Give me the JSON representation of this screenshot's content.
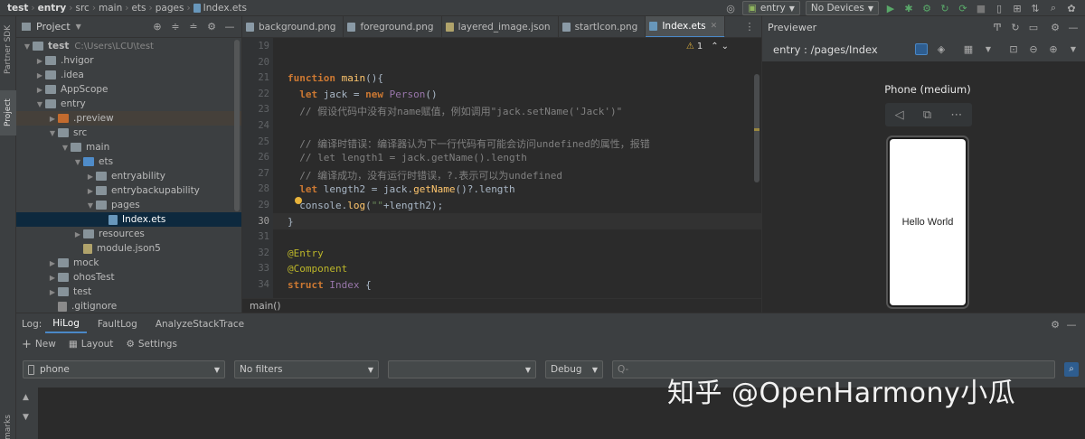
{
  "navbar": {
    "crumbs": [
      "test",
      "entry",
      "src",
      "main",
      "ets",
      "pages",
      "Index.ets"
    ],
    "entry_combo": "entry",
    "devices_combo": "No Devices"
  },
  "toolstrip": {
    "partner_sdk": "Partner SDK",
    "project": "Project",
    "marks": "marks"
  },
  "project_panel": {
    "title": "Project",
    "tree": [
      {
        "label": "test",
        "hint": "C:\\Users\\LCU\\test",
        "depth": 0,
        "icon": "folder-plain",
        "open": true
      },
      {
        "label": ".hvigor",
        "depth": 1,
        "icon": "folder-plain",
        "open": false
      },
      {
        "label": ".idea",
        "depth": 1,
        "icon": "folder-plain",
        "open": false
      },
      {
        "label": "AppScope",
        "depth": 1,
        "icon": "folder-plain",
        "open": false
      },
      {
        "label": "entry",
        "depth": 1,
        "icon": "folder-plain",
        "open": true
      },
      {
        "label": ".preview",
        "depth": 2,
        "icon": "folder-orange",
        "open": false
      },
      {
        "label": "src",
        "depth": 2,
        "icon": "folder-plain",
        "open": true
      },
      {
        "label": "main",
        "depth": 3,
        "icon": "folder-plain",
        "open": true
      },
      {
        "label": "ets",
        "depth": 4,
        "icon": "folder-src",
        "open": true
      },
      {
        "label": "entryability",
        "depth": 5,
        "icon": "folder-plain",
        "open": false
      },
      {
        "label": "entrybackupability",
        "depth": 5,
        "icon": "folder-plain",
        "open": false
      },
      {
        "label": "pages",
        "depth": 5,
        "icon": "folder-plain",
        "open": true
      },
      {
        "label": "Index.ets",
        "depth": 6,
        "icon": "file-ets",
        "selected": true
      },
      {
        "label": "resources",
        "depth": 4,
        "icon": "folder-plain",
        "open": false
      },
      {
        "label": "module.json5",
        "depth": 4,
        "icon": "file-json"
      },
      {
        "label": "mock",
        "depth": 2,
        "icon": "folder-plain",
        "open": false
      },
      {
        "label": "ohosTest",
        "depth": 2,
        "icon": "folder-plain",
        "open": false
      },
      {
        "label": "test",
        "depth": 2,
        "icon": "folder-plain",
        "open": false
      },
      {
        "label": ".gitignore",
        "depth": 2,
        "icon": "file-gitignore"
      }
    ]
  },
  "tabs": [
    {
      "label": "background.png",
      "active": false
    },
    {
      "label": "foreground.png",
      "active": false
    },
    {
      "label": "layered_image.json",
      "active": false
    },
    {
      "label": "startIcon.png",
      "active": false
    },
    {
      "label": "Index.ets",
      "active": true
    }
  ],
  "editor": {
    "warning_count": "1",
    "status_breadcrumb": "main()",
    "line_numbers": [
      "19",
      "20",
      "21",
      "22",
      "23",
      "24",
      "25",
      "26",
      "27",
      "28",
      "29",
      "30",
      "31",
      "32",
      "33",
      "34"
    ],
    "lines": [
      [],
      [],
      [
        {
          "t": "function ",
          "c": "kw"
        },
        {
          "t": "main",
          "c": "fn"
        },
        {
          "t": "(){",
          "c": "ident"
        }
      ],
      [
        {
          "t": "  let ",
          "c": "kw"
        },
        {
          "t": "jack = ",
          "c": "ident"
        },
        {
          "t": "new ",
          "c": "kw"
        },
        {
          "t": "Person",
          "c": "cls"
        },
        {
          "t": "()",
          "c": "ident"
        }
      ],
      [
        {
          "t": "  // 假设代码中没有对name赋值，例如调用\"jack.setName('Jack')\"",
          "c": "cm"
        }
      ],
      [],
      [
        {
          "t": "  // 编译时错误：编译器认为下一行代码有可能会访问undefined的属性，报错",
          "c": "cm"
        }
      ],
      [
        {
          "t": "  // let length1 = jack.getName().length",
          "c": "cm"
        }
      ],
      [
        {
          "t": "  // 编译成功，没有运行时错误，?.表示可以为undefined",
          "c": "cm"
        }
      ],
      [
        {
          "t": "  let ",
          "c": "kw"
        },
        {
          "t": "length2 = jack.",
          "c": "ident"
        },
        {
          "t": "getName",
          "c": "fn"
        },
        {
          "t": "()?.length",
          "c": "ident"
        }
      ],
      [
        {
          "t": "  console.",
          "c": "ident"
        },
        {
          "t": "log",
          "c": "fn"
        },
        {
          "t": "(",
          "c": "ident"
        },
        {
          "t": "\"\"",
          "c": "str"
        },
        {
          "t": "+length2);",
          "c": "ident"
        }
      ],
      [
        {
          "t": "}",
          "c": "ident"
        }
      ],
      [],
      [
        {
          "t": "@Entry",
          "c": "ann"
        }
      ],
      [
        {
          "t": "@Component",
          "c": "ann"
        }
      ],
      [
        {
          "t": "struct ",
          "c": "kw"
        },
        {
          "t": "Index ",
          "c": "cls"
        },
        {
          "t": "{",
          "c": "ident"
        }
      ]
    ]
  },
  "previewer": {
    "title": "Previewer",
    "route": "entry : /pages/Index",
    "device": "Phone (medium)",
    "screen_text": "Hello World"
  },
  "log": {
    "label": "Log:",
    "tabs": [
      "HiLog",
      "FaultLog",
      "AnalyzeStackTrace"
    ],
    "toolbar": {
      "new": "New",
      "layout": "Layout",
      "settings": "Settings"
    },
    "device_filter": "phone",
    "filter": "No filters",
    "process": "",
    "level": "Debug",
    "search_placeholder": "Q-"
  },
  "watermark": "知乎 @OpenHarmony小瓜",
  "colors": {
    "accent": "#4a88c7",
    "keyword": "#cc7832",
    "function": "#ffc66d",
    "comment": "#808080",
    "annotation": "#bbb529"
  }
}
